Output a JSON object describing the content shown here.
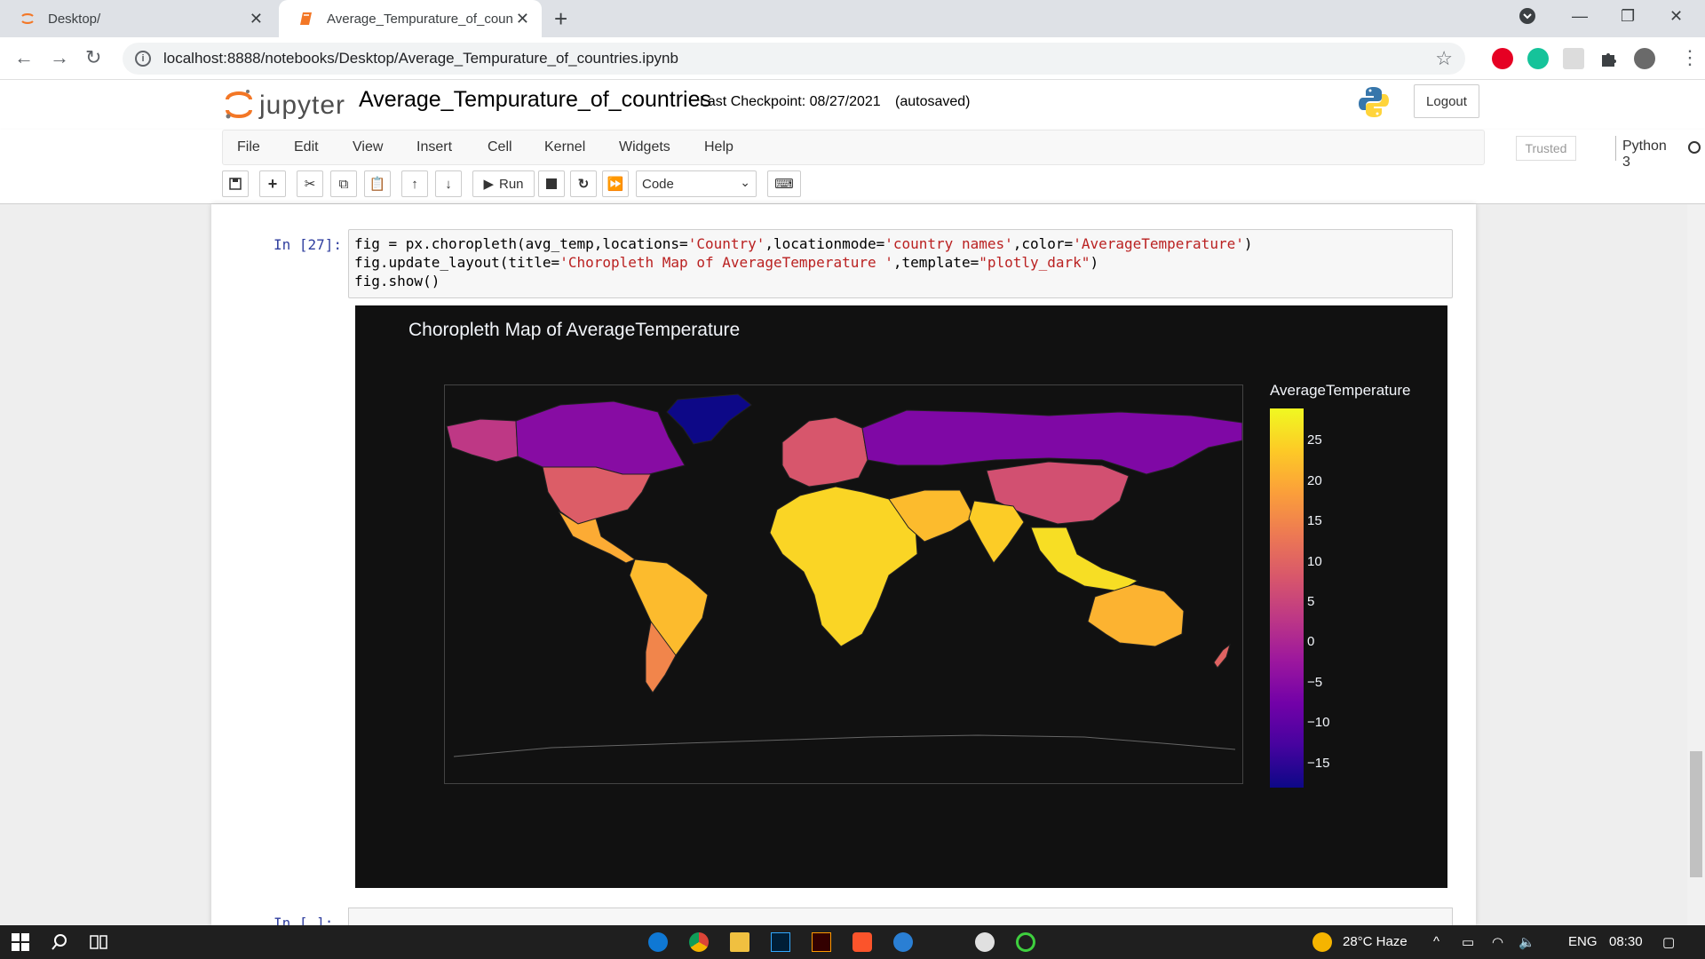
{
  "browser": {
    "tabs": [
      {
        "title": "Desktop/",
        "active": false
      },
      {
        "title": "Average_Tempurature_of_countri",
        "active": true
      }
    ],
    "url": "localhost:8888/notebooks/Desktop/Average_Tempurature_of_countries.ipynb"
  },
  "jupyter": {
    "logo_text": "jupyter",
    "notebook_name": "Average_Tempurature_of_countries",
    "checkpoint": "Last Checkpoint: 08/27/2021",
    "autosaved": "(autosaved)",
    "logout": "Logout",
    "menu": [
      "File",
      "Edit",
      "View",
      "Insert",
      "Cell",
      "Kernel",
      "Widgets",
      "Help"
    ],
    "trusted": "Trusted",
    "kernel": "Python 3",
    "run_label": "Run",
    "cell_type": "Code"
  },
  "cell": {
    "prompt": "In [27]:",
    "code_line1_a": "fig = px.choropleth(avg_temp,locations=",
    "code_line1_s1": "'Country'",
    "code_line1_b": ",locationmode=",
    "code_line1_s2": "'country names'",
    "code_line1_c": ",color=",
    "code_line1_s3": "'AverageTemperature'",
    "code_line1_d": ")",
    "code_line2_a": "fig.update_layout(title=",
    "code_line2_s1": "'Choropleth Map of AverageTemperature '",
    "code_line2_b": ",template=",
    "code_line2_s2": "\"plotly_dark\"",
    "code_line2_c": ")",
    "code_line3": "fig.show()"
  },
  "next_cell": {
    "prompt": "In [ ]:"
  },
  "chart_data": {
    "type": "choropleth",
    "title": "Choropleth Map of AverageTemperature",
    "colorbar_title": "AverageTemperature",
    "colorbar_ticks": [
      "25",
      "20",
      "15",
      "10",
      "5",
      "0",
      "−10",
      "−15",
      "−5"
    ],
    "colorbar_tick_values": [
      25,
      20,
      15,
      10,
      5,
      0,
      -10,
      -15,
      -5
    ],
    "color_range": [
      -18,
      29
    ],
    "colorscale": [
      "#0d0887",
      "#46039f",
      "#7201a8",
      "#9c179e",
      "#bd3786",
      "#d8576b",
      "#ed7953",
      "#fb9f3a",
      "#fdca26",
      "#f0f921"
    ],
    "regions": [
      {
        "name": "Greenland",
        "value": -18
      },
      {
        "name": "Canada",
        "value": -5
      },
      {
        "name": "Alaska",
        "value": 3
      },
      {
        "name": "United States",
        "value": 9
      },
      {
        "name": "Mexico",
        "value": 20
      },
      {
        "name": "South America",
        "value": 22
      },
      {
        "name": "Argentina",
        "value": 15
      },
      {
        "name": "Europe",
        "value": 8
      },
      {
        "name": "Russia",
        "value": -6
      },
      {
        "name": "Africa",
        "value": 25
      },
      {
        "name": "Middle East",
        "value": 22
      },
      {
        "name": "China",
        "value": 7
      },
      {
        "name": "India",
        "value": 24
      },
      {
        "name": "Southeast Asia",
        "value": 26
      },
      {
        "name": "Australia",
        "value": 21
      },
      {
        "name": "New Zealand",
        "value": 10
      }
    ]
  },
  "taskbar": {
    "weather": "28°C  Haze",
    "lang": "ENG",
    "time": "08:30"
  }
}
